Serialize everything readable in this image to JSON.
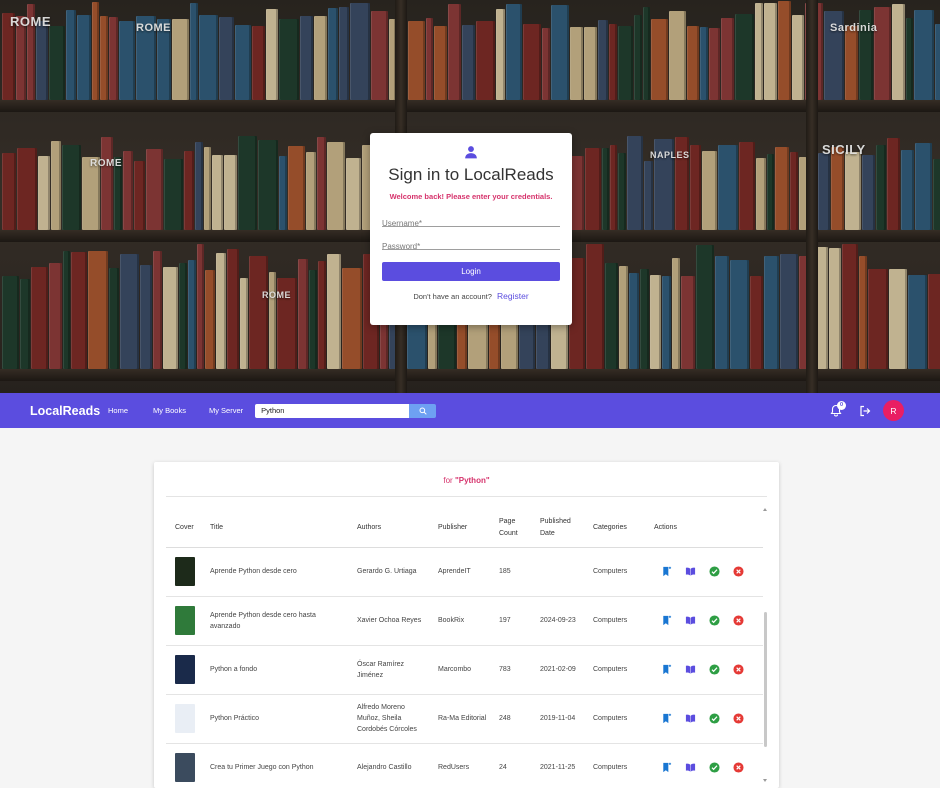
{
  "login": {
    "title": "Sign in to LocalReads",
    "subtitle": "Welcome back! Please enter your credentials.",
    "username_placeholder": "Username*",
    "password_placeholder": "Password*",
    "login_label": "Login",
    "no_account_text": "Don't have an account?",
    "register_label": "Register",
    "icon": "user-icon",
    "accent": "#5b4ddf",
    "subtitle_color": "#d6336c"
  },
  "hero": {
    "spine_titles": [
      "ROME",
      "ROME",
      "ROME",
      "ROME",
      "Sardinia",
      "SICILY",
      "NAPLES",
      "ROME"
    ],
    "background_palette": [
      "#7a2a26",
      "#2f5b7a",
      "#c9b48a",
      "#1f3d2e",
      "#8b3a3a",
      "#d9c9a3",
      "#394a66",
      "#a8562f"
    ]
  },
  "nav": {
    "brand": "LocalReads",
    "links": [
      "Home",
      "My Books",
      "My Server"
    ],
    "search_value": "Python",
    "notification_count": "0",
    "avatar_initial": "R",
    "color": "#5b4ddf",
    "avatar_color": "#e91e63"
  },
  "results": {
    "heading_prefix": "for",
    "query": "\"Python\"",
    "columns": {
      "cover": "Cover",
      "title": "Title",
      "authors": "Authors",
      "publisher": "Publisher",
      "page_count": "Page Count",
      "published_date": "Published Date",
      "categories": "Categories",
      "actions": "Actions"
    },
    "rows": [
      {
        "cover_color": "#1d2a1a",
        "title": "Aprende Python desde cero",
        "authors": "Gerardo G. Urtiaga",
        "publisher": "AprendeIT",
        "pages": "185",
        "date": "",
        "category": "Computers"
      },
      {
        "cover_color": "#2f7a3a",
        "title": "Aprende Python desde cero hasta avanzado",
        "authors": "Xavier Ochoa Reyes",
        "publisher": "BookRix",
        "pages": "197",
        "date": "2024-09-23",
        "category": "Computers"
      },
      {
        "cover_color": "#1a2a4a",
        "title": "Python a fondo",
        "authors": "Óscar Ramírez Jiménez",
        "publisher": "Marcombo",
        "pages": "783",
        "date": "2021-02-09",
        "category": "Computers"
      },
      {
        "cover_color": "#e9eef5",
        "title": "Python Práctico",
        "authors": "Alfredo Moreno Muñoz, Sheila Cordobés Córcoles",
        "publisher": "Ra-Ma Editorial",
        "pages": "248",
        "date": "2019-11-04",
        "category": "Computers"
      },
      {
        "cover_color": "#3b4b5e",
        "title": "Crea tu Primer Juego con Python",
        "authors": "Alejandro Castillo",
        "publisher": "RedUsers",
        "pages": "24",
        "date": "2021-11-25",
        "category": "Computers"
      }
    ],
    "action_icons": [
      "bookmark-add-icon",
      "read-book-icon",
      "check-circle-icon",
      "cancel-circle-icon"
    ],
    "action_colors": [
      "#1976d2",
      "#5b4ddf",
      "#2e9e44",
      "#e53935"
    ]
  }
}
